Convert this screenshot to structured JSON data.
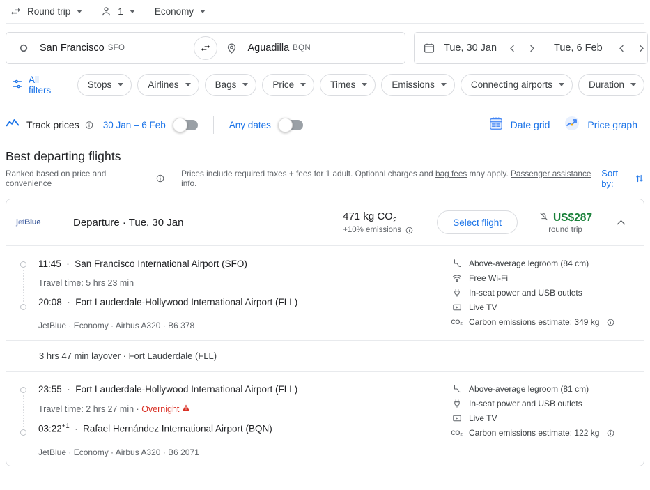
{
  "options": {
    "trip_type": "Round trip",
    "passengers": "1",
    "cabin": "Economy"
  },
  "search": {
    "origin_city": "San Francisco",
    "origin_code": "SFO",
    "destination_city": "Aguadilla",
    "destination_code": "BQN",
    "depart_date": "Tue, 30 Jan",
    "return_date": "Tue, 6 Feb"
  },
  "filters": {
    "all_filters": "All filters",
    "chips": [
      "Stops",
      "Airlines",
      "Bags",
      "Price",
      "Times",
      "Emissions",
      "Connecting airports",
      "Duration"
    ]
  },
  "track": {
    "label": "Track prices",
    "date_range": "30 Jan – 6 Feb",
    "any_dates": "Any dates",
    "date_grid": "Date grid",
    "price_graph": "Price graph"
  },
  "section": {
    "title": "Best departing flights",
    "ranked_note": "Ranked based on price and convenience",
    "prices_note_a": "Prices include required taxes + fees for 1 adult. Optional charges and ",
    "prices_note_bag": "bag fees",
    "prices_note_b": " may apply. ",
    "prices_note_assist": "Passenger assistance",
    "prices_note_c": " info.",
    "sort_by": "Sort by:"
  },
  "flight": {
    "airline_logo_a": "jet",
    "airline_logo_b": "Blue",
    "header_title": "Departure  ·  Tue, 30 Jan",
    "co2_amount": "471 kg CO",
    "co2_sub": "2",
    "emissions_delta": "+10% emissions",
    "select_label": "Select flight",
    "price": "US$287",
    "price_sub": "round trip",
    "legs": [
      {
        "depart_time": "11:45",
        "depart_airport": "San Francisco International Airport (SFO)",
        "travel_time": "Travel time: 5 hrs 23 min",
        "overnight": "",
        "arrive_time": "20:08",
        "arrive_plus": "",
        "arrive_airport": "Fort Lauderdale-Hollywood International Airport (FLL)",
        "meta": "JetBlue · Economy · Airbus A320 · B6 378",
        "amenities": [
          {
            "icon": "legroom-icon",
            "text": "Above-average legroom (84 cm)"
          },
          {
            "icon": "wifi-icon",
            "text": "Free Wi-Fi"
          },
          {
            "icon": "power-icon",
            "text": "In-seat power and USB outlets"
          },
          {
            "icon": "tv-icon",
            "text": "Live TV"
          },
          {
            "icon": "co2-icon",
            "text": "Carbon emissions estimate: 349 kg"
          }
        ]
      },
      {
        "depart_time": "23:55",
        "depart_airport": "Fort Lauderdale-Hollywood International Airport (FLL)",
        "travel_time": "Travel time: 2 hrs 27 min ·",
        "overnight": "Overnight",
        "arrive_time": "03:22",
        "arrive_plus": "+1",
        "arrive_airport": "Rafael Hernández International Airport (BQN)",
        "meta": "JetBlue · Economy · Airbus A320 · B6 2071",
        "amenities": [
          {
            "icon": "legroom-icon",
            "text": "Above-average legroom (81 cm)"
          },
          {
            "icon": "power-icon",
            "text": "In-seat power and USB outlets"
          },
          {
            "icon": "tv-icon",
            "text": "Live TV"
          },
          {
            "icon": "co2-icon",
            "text": "Carbon emissions estimate: 122 kg"
          }
        ]
      }
    ],
    "layover": "3 hrs 47 min layover · Fort Lauderdale (FLL)"
  },
  "colors": {
    "accent_blue": "#1a73e8",
    "price_green": "#188038",
    "warning_red": "#d93025",
    "border": "#dadce0",
    "text_secondary": "#5f6368"
  }
}
